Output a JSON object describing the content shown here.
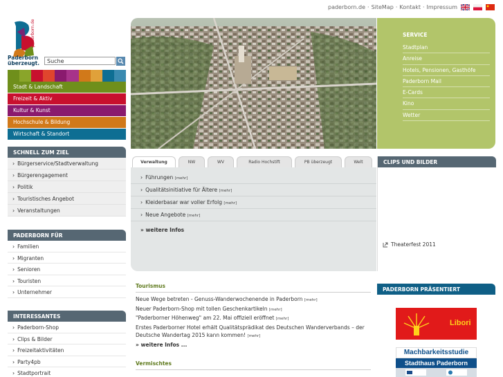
{
  "top_links": {
    "home": "paderborn.de",
    "sitemap": "SiteMap",
    "kontakt": "Kontakt",
    "impressum": "Impressum",
    "sep": "·"
  },
  "logo": {
    "vertical_text": "paderborn.de",
    "line1": "Paderborn",
    "line2": "überzeugt."
  },
  "search": {
    "label": "Suche"
  },
  "main_nav": [
    {
      "label": "Stadt & Landschaft",
      "color": "#6f8f1b"
    },
    {
      "label": "Freizeit & Aktiv",
      "color": "#c8102e"
    },
    {
      "label": "Kultur & Kunst",
      "color": "#8a1a6e"
    },
    {
      "label": "Hochschule & Bildung",
      "color": "#d1791a"
    },
    {
      "label": "Wirtschaft & Standort",
      "color": "#0e6e93"
    }
  ],
  "schnell": {
    "title": "SCHNELL ZUM ZIEL",
    "items": [
      "Bürgerservice/Stadtverwaltung",
      "Bürgerengagement",
      "Politik",
      "Touristisches Angebot",
      "Veranstaltungen"
    ]
  },
  "paderborn_fuer": {
    "title": "PADERBORN FÜR",
    "items": [
      "Familien",
      "Migranten",
      "Senioren",
      "Touristen",
      "Unternehmer"
    ]
  },
  "interessantes": {
    "title": "INTERESSANTES",
    "items": [
      "Paderborn-Shop",
      "Clips & Bilder",
      "Freizeitaktivitäten",
      "Party4pb",
      "Stadtportrait"
    ]
  },
  "service": {
    "title": "SERVICE",
    "items": [
      "Stadtplan",
      "Anreise",
      "Hotels, Pensionen, Gasthöfe",
      "Paderborn Mail",
      "E-Cards",
      "Kino",
      "Wetter"
    ]
  },
  "tabs": [
    "Verwaltung",
    "NW",
    "WV",
    "Radio Hochstift",
    "PB überzeugt",
    "Welt"
  ],
  "tab_items": [
    {
      "text": "Führungen",
      "mehr": "[mehr]"
    },
    {
      "text": "Qualitätsinitiative für Ältere",
      "mehr": "[mehr]"
    },
    {
      "text": "Kleiderbasar war voller Erfolg",
      "mehr": "[mehr]"
    },
    {
      "text": "Neue Angebote",
      "mehr": "[mehr]"
    }
  ],
  "tab_more": "weitere Infos",
  "clips": {
    "title": "CLIPS UND BILDER",
    "item": "Theaterfest 2011"
  },
  "tourismus": {
    "title": "Tourismus",
    "items": [
      {
        "text": "Neue Wege betreten - Genuss-Wanderwochenende in Paderborn",
        "mehr": "[mehr]"
      },
      {
        "text": "Neuer Paderborn-Shop mit tollen Geschenkartikeln",
        "mehr": "[mehr]"
      },
      {
        "text": "\"Paderborner Höhenweg\" am 22. Mai offiziell eröffnet",
        "mehr": "[mehr]"
      },
      {
        "text": "Erstes Paderborner Hotel erhält Qualitätsprädikat des Deutschen Wanderverbands – der Deutsche Wandertag 2015 kann kommen!",
        "mehr": "[mehr]"
      }
    ],
    "more": "weitere Infos ..."
  },
  "vermischtes": {
    "title": "Vermischtes"
  },
  "praesentiert": {
    "title": "PADERBORN PRÄSENTIERT",
    "libori_label": "Libori",
    "machbarkeit_line1": "Machbarkeitsstudie",
    "machbarkeit_line2": "Stadthaus Paderborn"
  }
}
